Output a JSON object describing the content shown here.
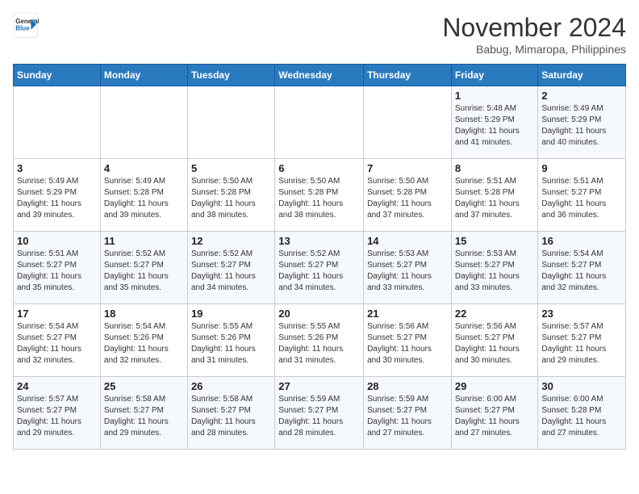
{
  "logo": {
    "line1": "General",
    "line2": "Blue"
  },
  "title": "November 2024",
  "location": "Babug, Mimaropa, Philippines",
  "header_days": [
    "Sunday",
    "Monday",
    "Tuesday",
    "Wednesday",
    "Thursday",
    "Friday",
    "Saturday"
  ],
  "weeks": [
    [
      {
        "day": "",
        "detail": ""
      },
      {
        "day": "",
        "detail": ""
      },
      {
        "day": "",
        "detail": ""
      },
      {
        "day": "",
        "detail": ""
      },
      {
        "day": "",
        "detail": ""
      },
      {
        "day": "1",
        "detail": "Sunrise: 5:48 AM\nSunset: 5:29 PM\nDaylight: 11 hours\nand 41 minutes."
      },
      {
        "day": "2",
        "detail": "Sunrise: 5:49 AM\nSunset: 5:29 PM\nDaylight: 11 hours\nand 40 minutes."
      }
    ],
    [
      {
        "day": "3",
        "detail": "Sunrise: 5:49 AM\nSunset: 5:29 PM\nDaylight: 11 hours\nand 39 minutes."
      },
      {
        "day": "4",
        "detail": "Sunrise: 5:49 AM\nSunset: 5:28 PM\nDaylight: 11 hours\nand 39 minutes."
      },
      {
        "day": "5",
        "detail": "Sunrise: 5:50 AM\nSunset: 5:28 PM\nDaylight: 11 hours\nand 38 minutes."
      },
      {
        "day": "6",
        "detail": "Sunrise: 5:50 AM\nSunset: 5:28 PM\nDaylight: 11 hours\nand 38 minutes."
      },
      {
        "day": "7",
        "detail": "Sunrise: 5:50 AM\nSunset: 5:28 PM\nDaylight: 11 hours\nand 37 minutes."
      },
      {
        "day": "8",
        "detail": "Sunrise: 5:51 AM\nSunset: 5:28 PM\nDaylight: 11 hours\nand 37 minutes."
      },
      {
        "day": "9",
        "detail": "Sunrise: 5:51 AM\nSunset: 5:27 PM\nDaylight: 11 hours\nand 36 minutes."
      }
    ],
    [
      {
        "day": "10",
        "detail": "Sunrise: 5:51 AM\nSunset: 5:27 PM\nDaylight: 11 hours\nand 35 minutes."
      },
      {
        "day": "11",
        "detail": "Sunrise: 5:52 AM\nSunset: 5:27 PM\nDaylight: 11 hours\nand 35 minutes."
      },
      {
        "day": "12",
        "detail": "Sunrise: 5:52 AM\nSunset: 5:27 PM\nDaylight: 11 hours\nand 34 minutes."
      },
      {
        "day": "13",
        "detail": "Sunrise: 5:52 AM\nSunset: 5:27 PM\nDaylight: 11 hours\nand 34 minutes."
      },
      {
        "day": "14",
        "detail": "Sunrise: 5:53 AM\nSunset: 5:27 PM\nDaylight: 11 hours\nand 33 minutes."
      },
      {
        "day": "15",
        "detail": "Sunrise: 5:53 AM\nSunset: 5:27 PM\nDaylight: 11 hours\nand 33 minutes."
      },
      {
        "day": "16",
        "detail": "Sunrise: 5:54 AM\nSunset: 5:27 PM\nDaylight: 11 hours\nand 32 minutes."
      }
    ],
    [
      {
        "day": "17",
        "detail": "Sunrise: 5:54 AM\nSunset: 5:27 PM\nDaylight: 11 hours\nand 32 minutes."
      },
      {
        "day": "18",
        "detail": "Sunrise: 5:54 AM\nSunset: 5:26 PM\nDaylight: 11 hours\nand 32 minutes."
      },
      {
        "day": "19",
        "detail": "Sunrise: 5:55 AM\nSunset: 5:26 PM\nDaylight: 11 hours\nand 31 minutes."
      },
      {
        "day": "20",
        "detail": "Sunrise: 5:55 AM\nSunset: 5:26 PM\nDaylight: 11 hours\nand 31 minutes."
      },
      {
        "day": "21",
        "detail": "Sunrise: 5:56 AM\nSunset: 5:27 PM\nDaylight: 11 hours\nand 30 minutes."
      },
      {
        "day": "22",
        "detail": "Sunrise: 5:56 AM\nSunset: 5:27 PM\nDaylight: 11 hours\nand 30 minutes."
      },
      {
        "day": "23",
        "detail": "Sunrise: 5:57 AM\nSunset: 5:27 PM\nDaylight: 11 hours\nand 29 minutes."
      }
    ],
    [
      {
        "day": "24",
        "detail": "Sunrise: 5:57 AM\nSunset: 5:27 PM\nDaylight: 11 hours\nand 29 minutes."
      },
      {
        "day": "25",
        "detail": "Sunrise: 5:58 AM\nSunset: 5:27 PM\nDaylight: 11 hours\nand 29 minutes."
      },
      {
        "day": "26",
        "detail": "Sunrise: 5:58 AM\nSunset: 5:27 PM\nDaylight: 11 hours\nand 28 minutes."
      },
      {
        "day": "27",
        "detail": "Sunrise: 5:59 AM\nSunset: 5:27 PM\nDaylight: 11 hours\nand 28 minutes."
      },
      {
        "day": "28",
        "detail": "Sunrise: 5:59 AM\nSunset: 5:27 PM\nDaylight: 11 hours\nand 27 minutes."
      },
      {
        "day": "29",
        "detail": "Sunrise: 6:00 AM\nSunset: 5:27 PM\nDaylight: 11 hours\nand 27 minutes."
      },
      {
        "day": "30",
        "detail": "Sunrise: 6:00 AM\nSunset: 5:28 PM\nDaylight: 11 hours\nand 27 minutes."
      }
    ]
  ]
}
